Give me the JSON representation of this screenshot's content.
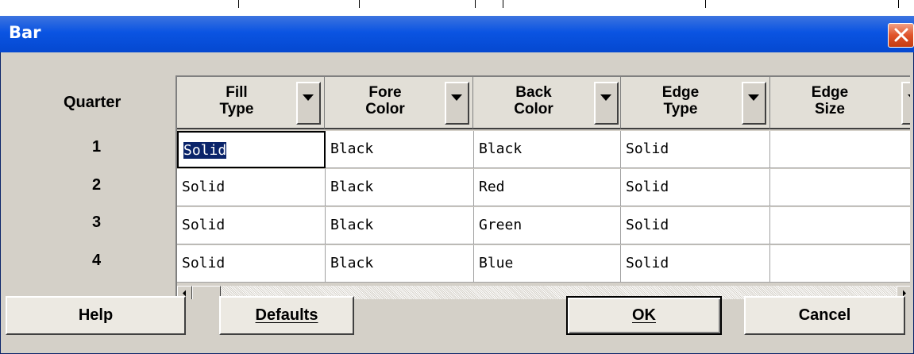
{
  "window": {
    "title": "Bar"
  },
  "row_header": {
    "title": "Quarter",
    "rows": [
      "1",
      "2",
      "3",
      "4"
    ]
  },
  "grid": {
    "columns": [
      {
        "line1": "Fill",
        "line2": "Type"
      },
      {
        "line1": "Fore",
        "line2": "Color"
      },
      {
        "line1": "Back",
        "line2": "Color"
      },
      {
        "line1": "Edge",
        "line2": "Type"
      },
      {
        "line1": "Edge",
        "line2": "Size"
      }
    ],
    "rows": [
      [
        "Solid",
        "Black",
        "Black",
        "Solid",
        ""
      ],
      [
        "Solid",
        "Black",
        "Red",
        "Solid",
        ""
      ],
      [
        "Solid",
        "Black",
        "Green",
        "Solid",
        ""
      ],
      [
        "Solid",
        "Black",
        "Blue",
        "Solid",
        ""
      ]
    ],
    "selected_cell": "Solid"
  },
  "buttons": {
    "help": "Help",
    "defaults": "Defaults",
    "ok": "OK",
    "cancel": "Cancel"
  },
  "icons": {
    "close": "close-icon",
    "dropdown": "triangle-down-icon",
    "scroll_left": "arrow-left-icon",
    "scroll_right": "arrow-right-icon"
  }
}
